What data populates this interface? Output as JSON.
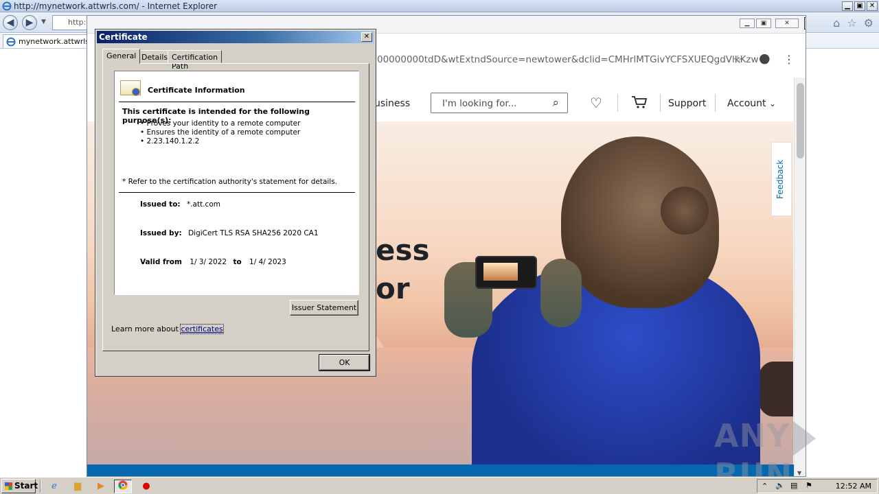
{
  "ie": {
    "title": "http://mynetwork.attwrls.com/ - Internet Explorer",
    "address_partial": "http:",
    "tab_label": "mynetwork.attwrls.c",
    "min": "▁",
    "max": "▣",
    "close": "✕"
  },
  "chrome": {
    "url_visible": "00000000tdD&wtExtndSource=newtower&dclid=CMHrlMTGivYCFSXUEQgdVlkKzw"
  },
  "att": {
    "business": "usiness",
    "search_placeholder": "I'm looking for...",
    "support": "Support",
    "account": "Account",
    "hero_line1": "ess",
    "hero_line2": "or",
    "feedback": "Feedback"
  },
  "watermark": {
    "left": "ANY",
    "right": "RUN"
  },
  "dialog": {
    "title": "Certificate",
    "tabs": [
      "General",
      "Details",
      "Certification Path"
    ],
    "info_title": "Certificate Information",
    "purpose_heading": "This certificate is intended for the following purpose(s):",
    "purposes": [
      "• Proves your identity to a remote computer",
      "• Ensures the identity of a remote computer",
      "• 2.23.140.1.2.2"
    ],
    "refer_note": "* Refer to the certification authority's statement for details.",
    "issued_to_label": "Issued to:",
    "issued_to": "*.att.com",
    "issued_by_label": "Issued by:",
    "issued_by": "DigiCert TLS RSA SHA256 2020 CA1",
    "valid_from_label": "Valid from",
    "valid_from": "1/ 3/ 2022",
    "to_label": "to",
    "valid_to": "1/ 4/ 2023",
    "issuer_button": "Issuer Statement",
    "learn_prefix": "Learn more about",
    "learn_link": "certificates",
    "ok": "OK"
  },
  "taskbar": {
    "start": "Start",
    "clock": "12:52 AM"
  }
}
